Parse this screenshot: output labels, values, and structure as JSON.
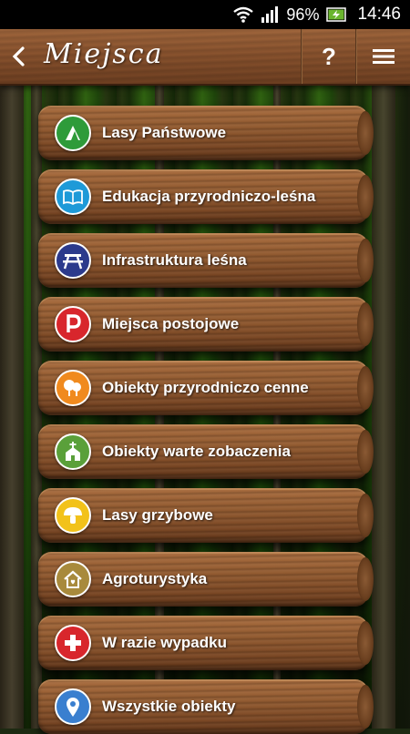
{
  "status_bar": {
    "battery": "96%",
    "time": "14:46"
  },
  "header": {
    "title": "Miejsca",
    "help_label": "?"
  },
  "items": [
    {
      "label": "Lasy Państwowe",
      "icon": "lasy-panstwowe-logo-icon",
      "color": "#2e9b3a"
    },
    {
      "label": "Edukacja przyrodniczo-leśna",
      "icon": "open-book-icon",
      "color": "#1e9ad8"
    },
    {
      "label": "Infrastruktura leśna",
      "icon": "picnic-table-icon",
      "color": "#2b3a8c"
    },
    {
      "label": "Miejsca postojowe",
      "icon": "parking-icon",
      "color": "#d8262c"
    },
    {
      "label": "Obiekty przyrodniczo cenne",
      "icon": "trees-icon",
      "color": "#f08a1e"
    },
    {
      "label": "Obiekty warte zobaczenia",
      "icon": "chapel-icon",
      "color": "#5aa03a"
    },
    {
      "label": "Lasy grzybowe",
      "icon": "mushroom-icon",
      "color": "#f2c21a"
    },
    {
      "label": "Agroturystyka",
      "icon": "house-icon",
      "color": "#a88a3c"
    },
    {
      "label": "W razie wypadku",
      "icon": "first-aid-cross-icon",
      "color": "#d8262c"
    },
    {
      "label": "Wszystkie obiekty",
      "icon": "map-pin-icon",
      "color": "#3a7fcf"
    }
  ]
}
